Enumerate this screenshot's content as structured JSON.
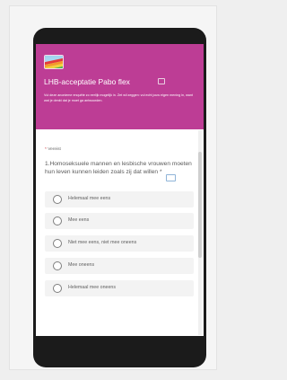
{
  "form": {
    "title": "LHB-acceptatie Pabo flex",
    "description": "Vul deze anonieme enquête zo eerlijk mogelijk in. Zet wil zeggen: vul echt jouw eigen mening in, want wat je denkt dat je moet ga antwoorden.",
    "required_note": "Vereist",
    "required_marker": "*"
  },
  "question": {
    "text": "1.Homoseksuele mannen en lesbische vrouwen moeten hun leven kunnen leiden zoals zij dat willen",
    "required_marker": "*",
    "options": [
      {
        "label": "Helemaal mee eens"
      },
      {
        "label": "Mee eens"
      },
      {
        "label": "Niet mee eens, niet mee oneens"
      },
      {
        "label": "Mee oneens"
      },
      {
        "label": "Helemaal mee oneens"
      }
    ]
  },
  "colors": {
    "banner": "#bd3d95",
    "required": "#c4262e",
    "phone_frame": "#1b1b1b",
    "option_bg": "#f3f3f3"
  },
  "icons": {
    "logo": "rainbow-flag-logo",
    "title": "image-icon",
    "question": "immersive-reader-icon"
  }
}
